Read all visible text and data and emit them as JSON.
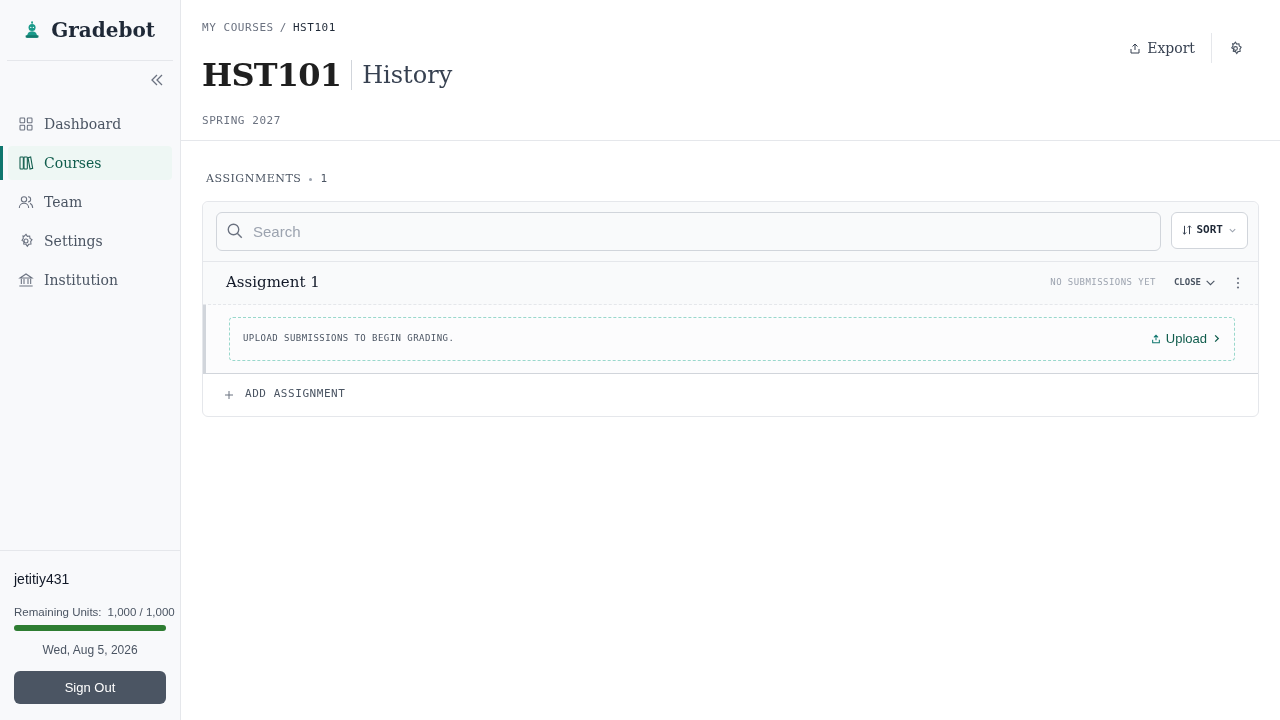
{
  "sidebar": {
    "brand": "Gradebot",
    "items": [
      {
        "kind": "dashboard",
        "label": "Dashboard",
        "selected": false
      },
      {
        "kind": "courses",
        "label": "Courses",
        "selected": true
      },
      {
        "kind": "team",
        "label": "Team",
        "selected": false
      },
      {
        "kind": "settings",
        "label": "Settings",
        "selected": false
      },
      {
        "kind": "institution",
        "label": "Institution",
        "selected": false
      }
    ],
    "user": {
      "name": "jetitiy431",
      "units_label": "Remaining Units:",
      "units_value": "1,000 / 1,000",
      "level": 1,
      "date": "Wed, Aug 5, 2026",
      "sign_out": "Sign Out"
    }
  },
  "breadcrumb": [
    "MY COURSES",
    "HST101"
  ],
  "breadcrumb_separator": "/",
  "header": {
    "code": "HST101",
    "name": "History",
    "term": "SPRING 2027",
    "export": "Export"
  },
  "assignments": {
    "heading": "ASSIGNMENTS",
    "count": "1",
    "search": {
      "placeholder": "Search"
    },
    "sort": "SORT",
    "items": [
      {
        "title": "Assigment 1",
        "status": "NO SUBMISSIONS YET",
        "toggle": "CLOSE",
        "expanded": true,
        "empty_text": "UPLOAD SUBMISSIONS TO BEGIN GRADING.",
        "upload": "Upload"
      }
    ],
    "add": "ADD ASSIGNMENT"
  }
}
